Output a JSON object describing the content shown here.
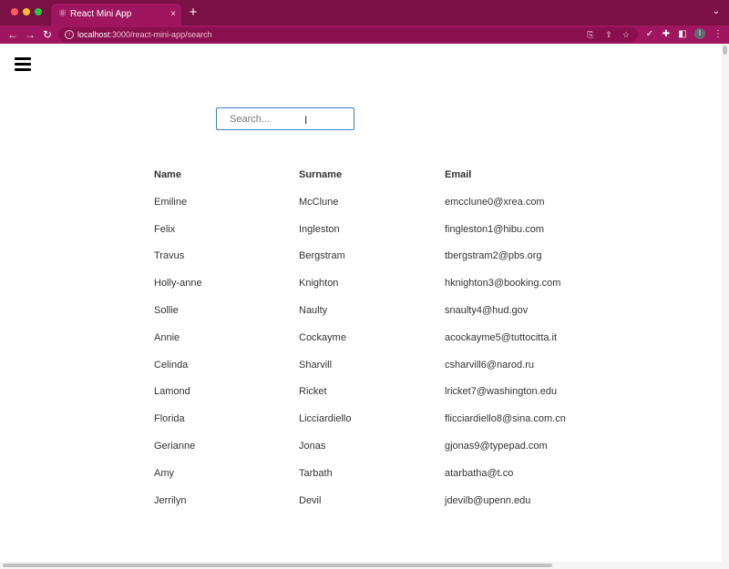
{
  "browser": {
    "tab_title": "React Mini App",
    "tab_close_icon": "×",
    "new_tab_icon": "+",
    "tab_menu_icon": "⌄",
    "url_host": "localhost",
    "url_path": ":3000/react-mini-app/search",
    "accent_color": "#a01560"
  },
  "search": {
    "placeholder": "Search...",
    "value": ""
  },
  "table": {
    "headers": [
      "Name",
      "Surname",
      "Email"
    ],
    "rows": [
      [
        "Emiline",
        "McClune",
        "emcclune0@xrea.com"
      ],
      [
        "Felix",
        "Ingleston",
        "fingleston1@hibu.com"
      ],
      [
        "Travus",
        "Bergstram",
        "tbergstram2@pbs.org"
      ],
      [
        "Holly-anne",
        "Knighton",
        "hknighton3@booking.com"
      ],
      [
        "Sollie",
        "Naulty",
        "snaulty4@hud.gov"
      ],
      [
        "Annie",
        "Cockayme",
        "acockayme5@tuttocitta.it"
      ],
      [
        "Celinda",
        "Sharvill",
        "csharvill6@narod.ru"
      ],
      [
        "Lamond",
        "Ricket",
        "lricket7@washington.edu"
      ],
      [
        "Florida",
        "Licciardiello",
        "flicciardiello8@sina.com.cn"
      ],
      [
        "Gerianne",
        "Jonas",
        "gjonas9@typepad.com"
      ],
      [
        "Amy",
        "Tarbath",
        "atarbatha@t.co"
      ],
      [
        "Jerrilyn",
        "Devil",
        "jdevilb@upenn.edu"
      ]
    ]
  }
}
